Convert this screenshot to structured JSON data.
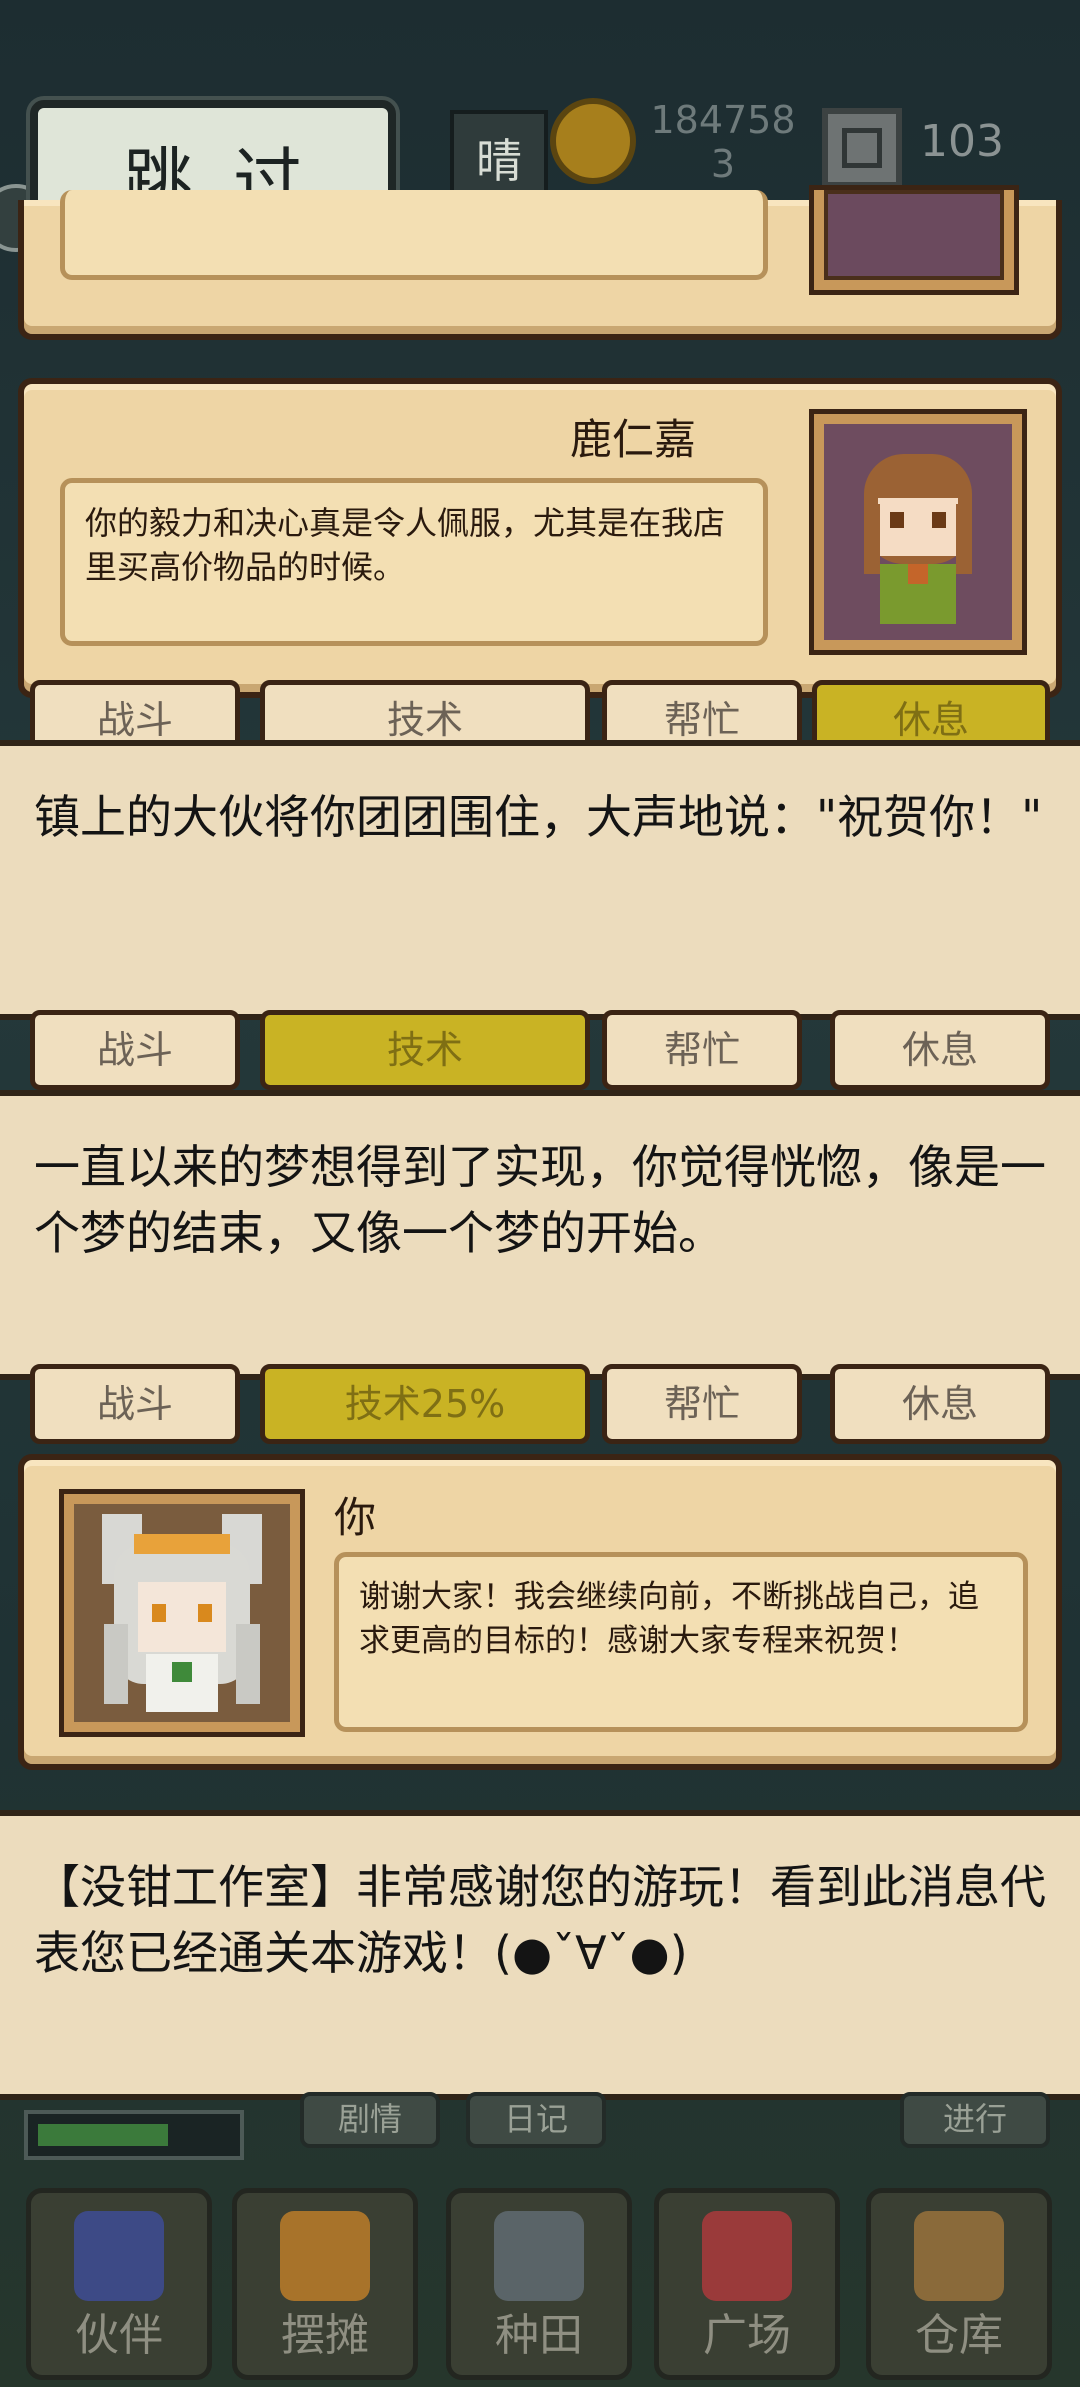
{
  "top": {
    "weather": "晴",
    "coins": "1847583",
    "gems": "103",
    "skip_label": "跳过"
  },
  "dialog_lurenjia": {
    "speaker": "鹿仁嘉",
    "text": "你的毅力和决心真是令人佩服，尤其是在我店里买高价物品的时候。"
  },
  "narration_1": "镇上的大伙将你团团围住，大声地说：\"祝贺你！\"",
  "narration_2": "一直以来的梦想得到了实现，你觉得恍惚，像是一个梦的结束，又像一个梦的开始。",
  "dialog_you": {
    "speaker": "你",
    "text": "谢谢大家！我会继续向前，不断挑战自己，追求更高的目标的！感谢大家专程来祝贺！"
  },
  "narration_3": "【没钳工作室】非常感谢您的游玩！看到此消息代表您已经通关本游戏！(●ˇ∀ˇ●)",
  "action_buttons_row1": [
    "战斗",
    "技术",
    "帮忙",
    "休息"
  ],
  "action_buttons_row2": [
    "战斗",
    "技术25%",
    "帮忙",
    "休息"
  ],
  "sub_tabs": [
    "剧情",
    "日记",
    "进行"
  ],
  "bottom_nav": [
    {
      "label": "伙伴",
      "icon": "partner-icon"
    },
    {
      "label": "摆摊",
      "icon": "stall-icon"
    },
    {
      "label": "种田",
      "icon": "farm-icon"
    },
    {
      "label": "广场",
      "icon": "square-icon"
    },
    {
      "label": "仓库",
      "icon": "warehouse-icon"
    }
  ],
  "colors": {
    "parchment": "#eed5a5",
    "border": "#3b2414",
    "narration_bg": "#ecdcbd"
  }
}
